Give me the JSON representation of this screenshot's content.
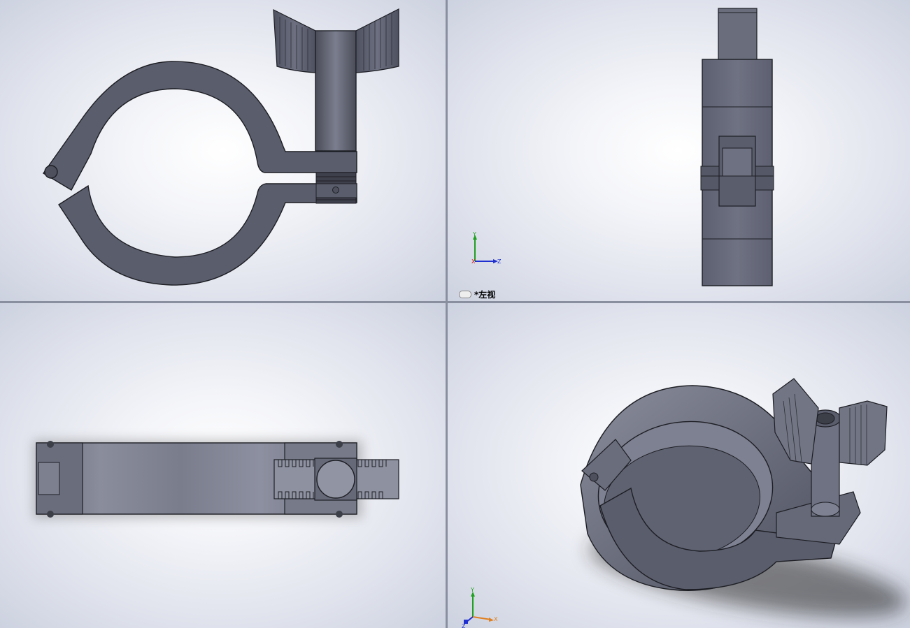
{
  "app": {
    "title": ""
  },
  "viewports": {
    "front": {
      "name": ""
    },
    "left": {
      "name": "*左视"
    },
    "top": {
      "name": ""
    },
    "iso": {
      "name": ""
    }
  },
  "triad": {
    "x": "X",
    "y": "Y",
    "z": "Z"
  },
  "colors": {
    "part": "#5a5d6c",
    "part_light": "#7a7d8e",
    "part_dark": "#3c3e48",
    "edge": "#1d1e24",
    "axis_x": "#d02020",
    "axis_y": "#20a020",
    "axis_z": "#2030d0"
  },
  "icons": [
    "link-icon",
    "triad-icon"
  ]
}
